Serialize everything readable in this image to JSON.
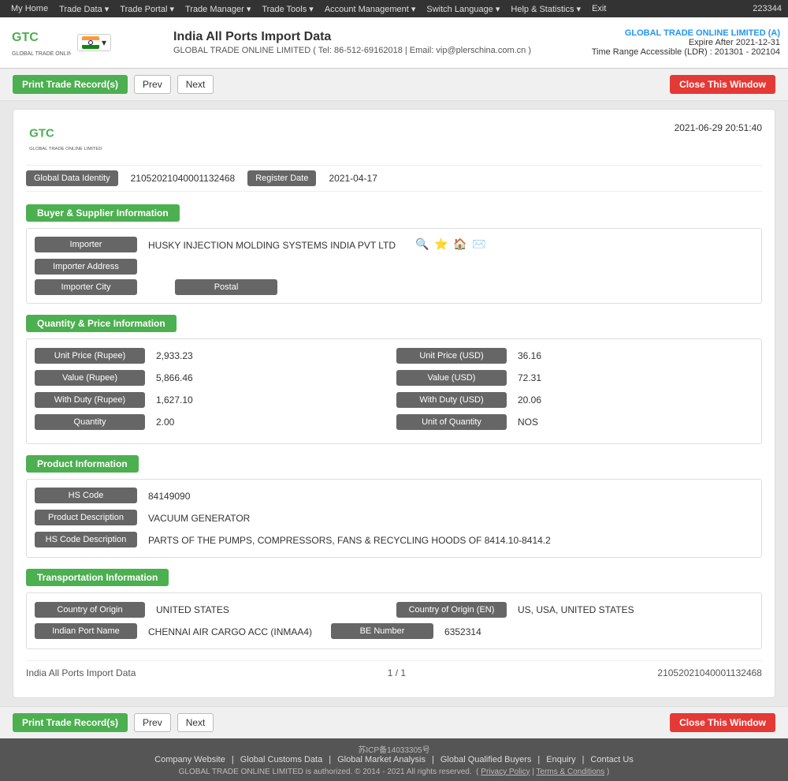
{
  "topnav": {
    "items": [
      "My Home",
      "Trade Data",
      "Trade Portal",
      "Trade Manager",
      "Trade Tools",
      "Account Management",
      "Switch Language",
      "Help & Statistics",
      "Exit"
    ],
    "user_id": "223344"
  },
  "header": {
    "title": "India All Ports Import Data",
    "subtitle": "GLOBAL TRADE ONLINE LIMITED ( Tel: 86-512-69162018 | Email: vip@plerschina.com.cn )",
    "company": "GLOBAL TRADE ONLINE LIMITED (A)",
    "expire": "Expire After 2021-12-31",
    "time_range": "Time Range Accessible (LDR) : 201301 - 202104"
  },
  "toolbar": {
    "print_label": "Print Trade Record(s)",
    "prev_label": "Prev",
    "next_label": "Next",
    "close_label": "Close This Window"
  },
  "record": {
    "datetime": "2021-06-29 20:51:40",
    "global_data_identity_label": "Global Data Identity",
    "global_data_identity_value": "21052021040001132468",
    "register_date_label": "Register Date",
    "register_date_value": "2021-04-17",
    "sections": {
      "buyer_supplier": {
        "title": "Buyer & Supplier Information",
        "fields": [
          {
            "label": "Importer",
            "value": "HUSKY INJECTION MOLDING SYSTEMS INDIA PVT LTD",
            "icons": true
          },
          {
            "label": "Importer Address",
            "value": ""
          },
          {
            "label": "Importer City",
            "value": "",
            "has_postal": true,
            "postal_label": "Postal",
            "postal_value": ""
          }
        ]
      },
      "quantity_price": {
        "title": "Quantity & Price Information",
        "grid_rows": [
          {
            "left_label": "Unit Price (Rupee)",
            "left_value": "2,933.23",
            "right_label": "Unit Price (USD)",
            "right_value": "36.16"
          },
          {
            "left_label": "Value (Rupee)",
            "left_value": "5,866.46",
            "right_label": "Value (USD)",
            "right_value": "72.31"
          },
          {
            "left_label": "With Duty (Rupee)",
            "left_value": "1,627.10",
            "right_label": "With Duty (USD)",
            "right_value": "20.06"
          },
          {
            "left_label": "Quantity",
            "left_value": "2.00",
            "right_label": "Unit of Quantity",
            "right_value": "NOS"
          }
        ]
      },
      "product": {
        "title": "Product Information",
        "fields": [
          {
            "label": "HS Code",
            "value": "84149090"
          },
          {
            "label": "Product Description",
            "value": "VACUUM GENERATOR"
          },
          {
            "label": "HS Code Description",
            "value": "PARTS OF THE PUMPS, COMPRESSORS, FANS & RECYCLING HOODS OF 8414.10-8414.2"
          }
        ]
      },
      "transportation": {
        "title": "Transportation Information",
        "grid_rows": [
          {
            "left_label": "Country of Origin",
            "left_value": "UNITED STATES",
            "right_label": "Country of Origin (EN)",
            "right_value": "US, USA, UNITED STATES"
          }
        ],
        "fields": [
          {
            "label": "Indian Port Name",
            "value": "CHENNAI AIR CARGO ACC (INMAA4)",
            "has_right": true,
            "right_label": "BE Number",
            "right_value": "6352314"
          }
        ]
      }
    },
    "footer": {
      "source": "India All Ports Import Data",
      "page": "1 / 1",
      "record_id": "21052021040001132468"
    }
  },
  "site_footer": {
    "icp": "苏ICP备14033305号",
    "links": [
      "Company Website",
      "Global Customs Data",
      "Global Market Analysis",
      "Global Qualified Buyers",
      "Enquiry",
      "Contact Us"
    ],
    "copyright": "GLOBAL TRADE ONLINE LIMITED is authorized. © 2014 - 2021 All rights reserved.",
    "privacy": "Privacy Policy",
    "terms": "Terms & Conditions"
  }
}
